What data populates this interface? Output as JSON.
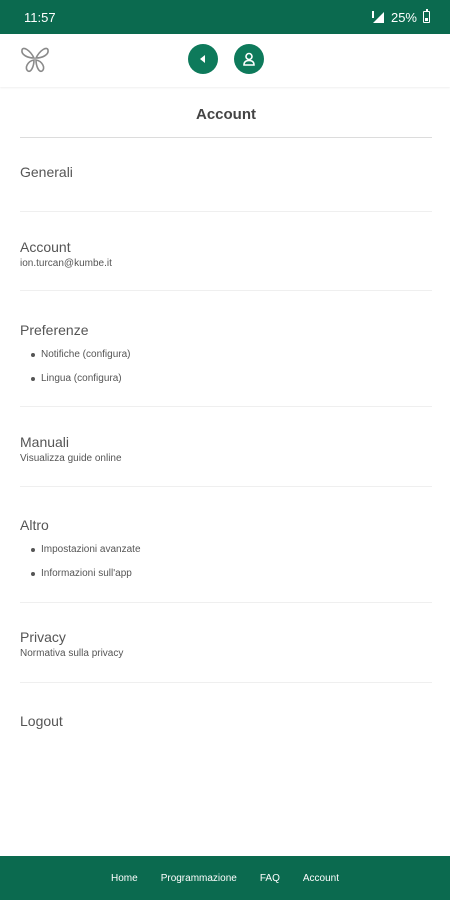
{
  "status_bar": {
    "time": "11:57",
    "battery": "25%"
  },
  "header": {
    "logo_icon": "butterfly-icon",
    "back_icon": "back-arrow-icon",
    "account_icon": "user-icon",
    "accent_color": "#0e7a5b"
  },
  "page": {
    "title": "Account"
  },
  "sections": {
    "generali": {
      "title": "Generali"
    },
    "account": {
      "title": "Account",
      "subtitle": "ion.turcan@kumbe.it"
    },
    "preferenze": {
      "title": "Preferenze",
      "items": [
        "Notifiche (configura)",
        "Lingua (configura)"
      ]
    },
    "manuali": {
      "title": "Manuali",
      "subtitle": "Visualizza guide online"
    },
    "altro": {
      "title": "Altro",
      "items": [
        "Impostazioni avanzate",
        "Informazioni sull'app"
      ]
    },
    "privacy": {
      "title": "Privacy",
      "subtitle": "Normativa sulla privacy"
    },
    "logout": {
      "title": "Logout"
    }
  },
  "bottom_nav": {
    "items": [
      "Home",
      "Programmazione",
      "FAQ",
      "Account"
    ]
  }
}
